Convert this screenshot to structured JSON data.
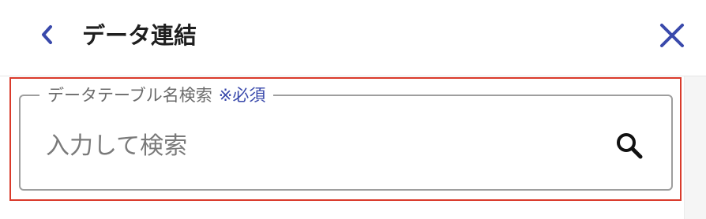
{
  "header": {
    "title": "データ連結",
    "back_icon": "chevron-left-icon",
    "close_icon": "close-icon",
    "accent_color": "#3949ab"
  },
  "search_field": {
    "label": "データテーブル名検索",
    "required_label": "※必須",
    "placeholder": "入力して検索",
    "value": "",
    "search_icon": "search-icon"
  },
  "highlight_color": "#d93a2b"
}
